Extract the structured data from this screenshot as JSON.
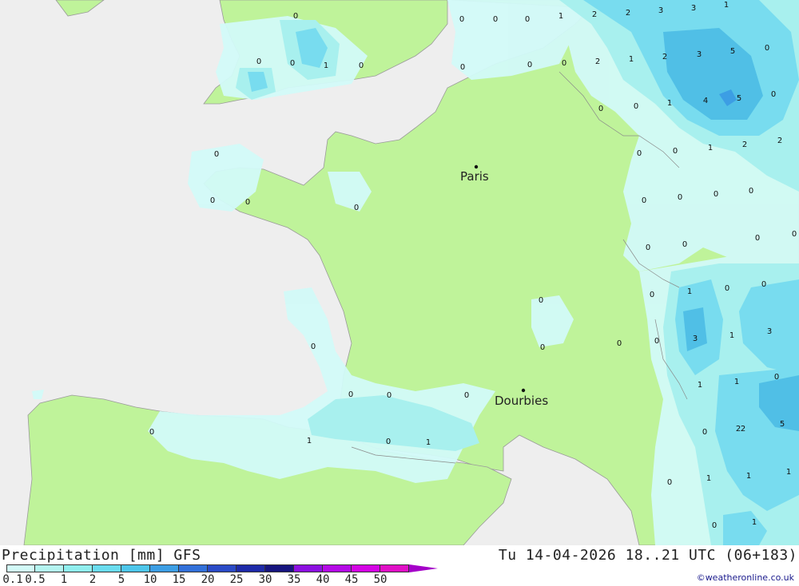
{
  "title": "Precipitation [mm] GFS",
  "datetime": "Tu 14-04-2026 18..21 UTC (06+183)",
  "credit": "©weatheronline.co.uk",
  "colors": {
    "sea": "#eeeeee",
    "land": "#bff39a",
    "precip_light": "#d2faf8",
    "precip_mid": "#a8f0ee",
    "precip_heavy": "#78dcef",
    "precip_strong": "#50bfe6"
  },
  "legend": {
    "labels": [
      "0.1",
      "0.5",
      "1",
      "2",
      "5",
      "10",
      "15",
      "20",
      "25",
      "30",
      "35",
      "40",
      "45",
      "50"
    ],
    "colors": [
      "#d2faf8",
      "#b4f4f0",
      "#90eeee",
      "#6adcee",
      "#4dc6ea",
      "#3c9ee4",
      "#3270d9",
      "#2a4ac6",
      "#1e2aa8",
      "#16147e",
      "#8c10e0",
      "#b40ae6",
      "#d404e4",
      "#e010c6"
    ]
  },
  "cities": [
    {
      "name": "Paris"
    },
    {
      "name": "Dourbies"
    }
  ],
  "values": [
    "0",
    "0",
    "1",
    "0",
    "0",
    "0",
    "0",
    "0",
    "0",
    "1",
    "2",
    "2",
    "3",
    "3",
    "1",
    "0",
    "0",
    "0",
    "2",
    "1",
    "2",
    "3",
    "5",
    "0",
    "0",
    "1",
    "4",
    "5",
    "0",
    "0",
    "0",
    "0",
    "1",
    "2",
    "2",
    "0",
    "0",
    "0",
    "0",
    "0",
    "0",
    "0",
    "0",
    "0",
    "0",
    "0",
    "0",
    "0",
    "0",
    "1",
    "0",
    "3",
    "1",
    "3",
    "0",
    "0",
    "0",
    "0",
    "0",
    "0",
    "0",
    "1",
    "1",
    "0",
    "1",
    "0",
    "1",
    "2",
    "0",
    "0",
    "2",
    "5",
    "0",
    "1",
    "1",
    "1",
    "0",
    "1"
  ]
}
